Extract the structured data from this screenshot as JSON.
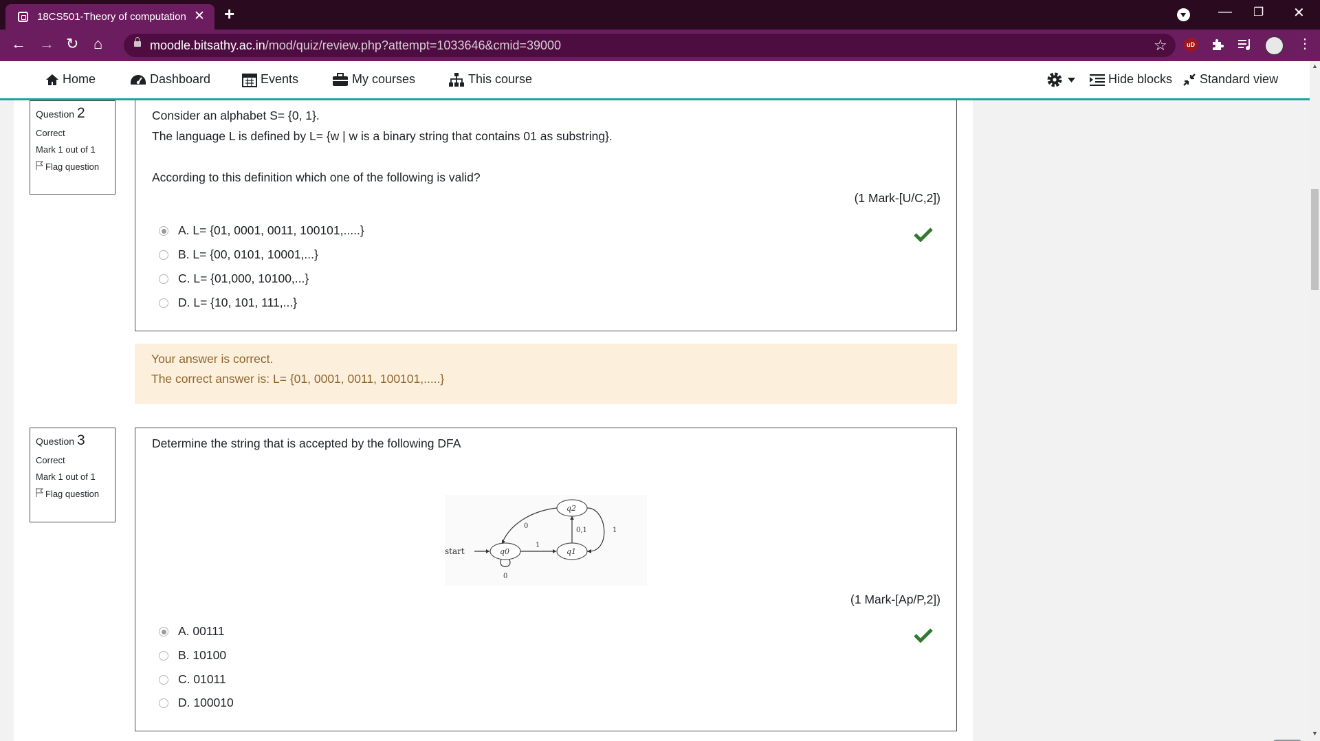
{
  "browser": {
    "tab_title": "18CS501-Theory of computation",
    "url_host": "moodle.bitsathy.ac.in",
    "url_path": "/mod/quiz/review.php?attempt=1033646&cmid=39000",
    "extension_label": "uD"
  },
  "nav": {
    "home": "Home",
    "dashboard": "Dashboard",
    "events": "Events",
    "my_courses": "My courses",
    "this_course": "This course",
    "hide_blocks": "Hide blocks",
    "standard_view": "Standard view"
  },
  "questions": [
    {
      "label": "Question",
      "number": "2",
      "state": "Correct",
      "grade": "Mark 1 out of 1",
      "flag": "Flag question",
      "text": [
        "Consider an alphabet S= {0, 1}.",
        "The language L is defined by L= {w | w is a binary string that contains 01 as substring}.",
        "According to this definition which one of the following is valid?"
      ],
      "marks": "(1 Mark-[U/C,2])",
      "options": [
        {
          "label": "A. L= {01, 0001, 0011, 100101,.....}",
          "selected": true
        },
        {
          "label": "B. L= {00, 0101, 10001,...}",
          "selected": false
        },
        {
          "label": "C. L= {01,000, 10100,...}",
          "selected": false
        },
        {
          "label": "D. L= {10, 101, 111,...}",
          "selected": false
        }
      ],
      "feedback": [
        "Your answer is correct.",
        "The correct answer is: L= {01, 0001, 0011, 100101,.....}"
      ]
    },
    {
      "label": "Question",
      "number": "3",
      "state": "Correct",
      "grade": "Mark 1 out of 1",
      "flag": "Flag question",
      "text": [
        "Determine the string that is accepted by the following DFA"
      ],
      "marks": "(1 Mark-[Ap/P,2])",
      "options": [
        {
          "label": "A. 00111",
          "selected": true
        },
        {
          "label": "B. 10100",
          "selected": false
        },
        {
          "label": "C. 01011",
          "selected": false
        },
        {
          "label": "D. 100010",
          "selected": false
        }
      ],
      "diagram": {
        "start": "start",
        "q0": "q0",
        "q1": "q1",
        "q2": "q2",
        "edge_q0_q1": "1",
        "edge_q0_self": "0",
        "edge_q2_q0": "0",
        "edge_q1_q2": "0,1",
        "edge_q2_q1": "1"
      }
    }
  ],
  "colors": {
    "tab_bg": "#2a0a1e",
    "chrome_bar": "#6c1d5f",
    "accent_line": "#1aa39a",
    "check_green": "#327a32",
    "feedback_bg": "#fcefdc",
    "feedback_text": "#8e662e"
  }
}
